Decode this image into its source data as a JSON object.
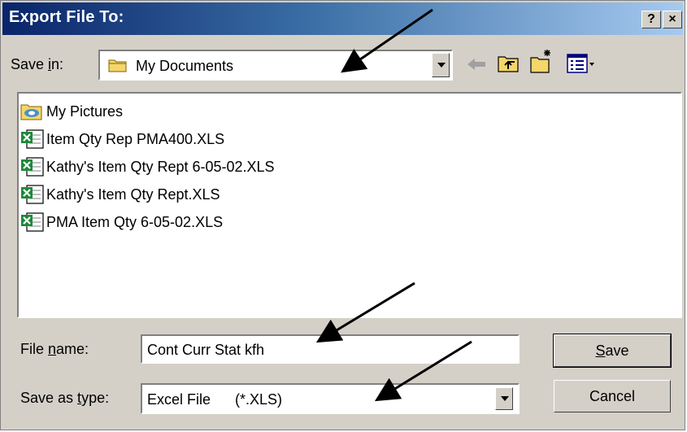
{
  "window": {
    "title": "Export File To:",
    "help_label": "?",
    "close_label": "×"
  },
  "save_in": {
    "label_pre": "Save ",
    "label_accel": "i",
    "label_post": "n:",
    "value": "My Documents"
  },
  "toolbar": {
    "icons": [
      "back-arrow-icon",
      "up-one-level-icon",
      "create-new-folder-icon",
      "view-menu-icon"
    ]
  },
  "files": [
    {
      "name": "My Pictures",
      "icon": "pictures-folder-icon"
    },
    {
      "name": "Item Qty Rep PMA400.XLS",
      "icon": "excel-file-icon"
    },
    {
      "name": "Kathy's Item Qty Rept 6-05-02.XLS",
      "icon": "excel-file-icon"
    },
    {
      "name": "Kathy's Item Qty Rept.XLS",
      "icon": "excel-file-icon"
    },
    {
      "name": "PMA Item Qty 6-05-02.XLS",
      "icon": "excel-file-icon"
    }
  ],
  "file_name": {
    "label_pre": "File ",
    "label_accel": "n",
    "label_post": "ame:",
    "value": "Cont Curr Stat kfh"
  },
  "save_as_type": {
    "label_pre": "Save as ",
    "label_accel": "t",
    "label_post": "ype:",
    "value": "Excel File      (*.XLS)"
  },
  "buttons": {
    "save_accel": "S",
    "save_rest": "ave",
    "cancel": "Cancel"
  },
  "colors": {
    "title_start": "#0a246a",
    "title_end": "#a6caf0",
    "dialog_face": "#d4d0c8",
    "excel_green": "#1c8a3a",
    "folder_yellow": "#f5d66a"
  }
}
